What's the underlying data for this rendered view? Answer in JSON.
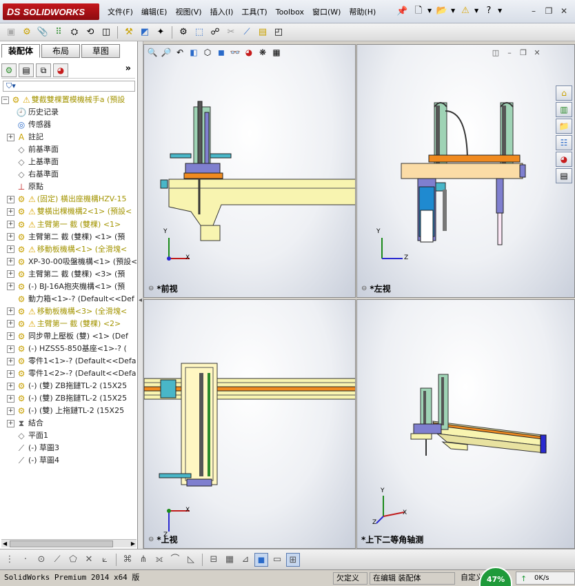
{
  "title_bar": {
    "logo": "SOLIDWORKS",
    "logo_prefix": "DS",
    "menu": [
      "文件(F)",
      "编辑(E)",
      "视图(V)",
      "插入(I)",
      "工具(T)",
      "Toolbox",
      "窗口(W)",
      "帮助(H)"
    ]
  },
  "feature_tree": {
    "tabs": [
      "装配体",
      "布局",
      "草图"
    ],
    "items": [
      {
        "label": "雙截雙棵置模機械手a  (預設",
        "icon": "assembly-icon",
        "warn": true,
        "color": "yellow",
        "expand": "−"
      },
      {
        "label": "历史记录",
        "icon": "history-icon",
        "warn": false,
        "color": "dark",
        "expand": ""
      },
      {
        "label": "传感器",
        "icon": "sensor-icon",
        "warn": false,
        "color": "dark",
        "expand": ""
      },
      {
        "label": "註記",
        "icon": "annotation-icon",
        "warn": false,
        "color": "dark",
        "expand": "+"
      },
      {
        "label": "前基準面",
        "icon": "plane-icon",
        "warn": false,
        "color": "dark",
        "expand": ""
      },
      {
        "label": "上基準面",
        "icon": "plane-icon",
        "warn": false,
        "color": "dark",
        "expand": ""
      },
      {
        "label": "右基準面",
        "icon": "plane-icon",
        "warn": false,
        "color": "dark",
        "expand": ""
      },
      {
        "label": "原點",
        "icon": "origin-icon",
        "warn": false,
        "color": "dark",
        "expand": ""
      },
      {
        "label": "(固定) 橫出座機構HZV-15",
        "icon": "assembly-icon",
        "warn": true,
        "color": "yellow",
        "expand": "+"
      },
      {
        "label": "雙橫出棵機構2<1> (預設<",
        "icon": "assembly-icon",
        "warn": true,
        "color": "yellow",
        "expand": "+"
      },
      {
        "label": "主臂第一 截 (雙棵) <1>",
        "icon": "assembly-icon",
        "warn": true,
        "color": "yellow",
        "expand": "+"
      },
      {
        "label": "主臂第二 截 (雙棵) <1> (預",
        "icon": "assembly-icon",
        "warn": false,
        "color": "dark",
        "expand": "+"
      },
      {
        "label": "移動板機構<1> (全滑塊<",
        "icon": "assembly-icon",
        "warn": true,
        "color": "yellow",
        "expand": "+"
      },
      {
        "label": "XP-30-00吸盤機構<1> (預設<",
        "icon": "assembly-icon",
        "warn": false,
        "color": "dark",
        "expand": "+"
      },
      {
        "label": "主臂第二 截 (雙棵) <3> (預",
        "icon": "assembly-icon",
        "warn": false,
        "color": "dark",
        "expand": "+"
      },
      {
        "label": "(-) BJ-16A抱夾機構<1> (預",
        "icon": "assembly-icon",
        "warn": false,
        "color": "dark",
        "expand": "+"
      },
      {
        "label": "動力箱<1>-? (Default<<Def",
        "icon": "part-icon",
        "warn": false,
        "color": "dark",
        "expand": ""
      },
      {
        "label": "移動板機構<3> (全滑塊<",
        "icon": "assembly-icon",
        "warn": true,
        "color": "yellow",
        "expand": "+"
      },
      {
        "label": "主臂第一 截 (雙棵) <2>",
        "icon": "assembly-icon",
        "warn": true,
        "color": "yellow",
        "expand": "+"
      },
      {
        "label": "同步帶上壓板 (雙) <1> (Def",
        "icon": "part-icon",
        "warn": false,
        "color": "dark",
        "expand": "+"
      },
      {
        "label": "(-) HZSS5-850基座<1>-? (",
        "icon": "part-icon",
        "warn": false,
        "color": "dark",
        "expand": "+"
      },
      {
        "label": "零件1<1>-? (Default<<Defa",
        "icon": "part-icon",
        "warn": false,
        "color": "dark",
        "expand": "+"
      },
      {
        "label": "零件1<2>-? (Default<<Defa",
        "icon": "part-icon",
        "warn": false,
        "color": "dark",
        "expand": "+"
      },
      {
        "label": "(-) (雙) ZB拖鏈TL-2 (15X25",
        "icon": "part-icon",
        "warn": false,
        "color": "dark",
        "expand": "+"
      },
      {
        "label": "(-) (雙) ZB拖鏈TL-2 (15X25",
        "icon": "part-icon",
        "warn": false,
        "color": "dark",
        "expand": "+"
      },
      {
        "label": "(-) (雙) 上拖鏈TL-2 (15X25",
        "icon": "part-icon",
        "warn": false,
        "color": "dark",
        "expand": "+"
      },
      {
        "label": "結合",
        "icon": "mate-icon",
        "warn": false,
        "color": "dark",
        "expand": "+"
      },
      {
        "label": "平面1",
        "icon": "plane-icon",
        "warn": false,
        "color": "dark",
        "expand": ""
      },
      {
        "label": "(-) 草圖3",
        "icon": "sketch-icon",
        "warn": false,
        "color": "dark",
        "expand": ""
      },
      {
        "label": "(-) 草圖4",
        "icon": "sketch-icon",
        "warn": false,
        "color": "dark",
        "expand": ""
      }
    ]
  },
  "viewports": {
    "front": "*前视",
    "left": "*左视",
    "top": "*上视",
    "iso": "*上下二等角轴测"
  },
  "axes": {
    "x": "X",
    "y": "Y",
    "z": "Z"
  },
  "status_bar": {
    "version": "SolidWorks Premium 2014 x64 版",
    "state": "欠定义",
    "editing": "在编辑 装配体",
    "custom": "自定义",
    "gauge": "47%",
    "net": "0K/s"
  },
  "colors": {
    "accent_red": "#c4161c",
    "model_yellow": "#f8f4b0",
    "model_purple": "#7f7fcf",
    "model_teal": "#49b6c8",
    "model_orange": "#f08a1f",
    "gauge_green": "#1f9a3a"
  }
}
